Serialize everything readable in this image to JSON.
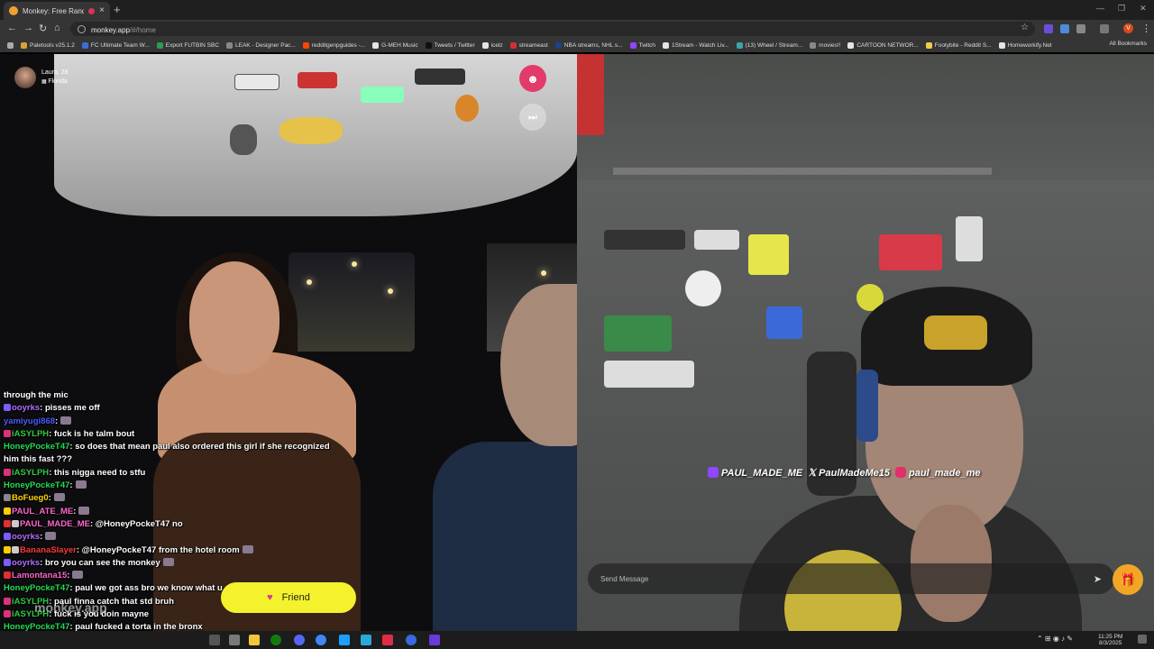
{
  "browser": {
    "tab_title": "Monkey: Free Random Vid",
    "url_host": "monkey.app",
    "url_path": "/#/home",
    "all_bookmarks_label": "All Bookmarks",
    "profile_initial": "V",
    "bookmarks": [
      {
        "label": "Paletools v25.1.2",
        "color": "#d7a23a"
      },
      {
        "label": "FC Ultimate Team W...",
        "color": "#3a6ed7"
      },
      {
        "label": "Export FUTBIN SBC",
        "color": "#2e9b4f"
      },
      {
        "label": "LEAK - Designer Pac...",
        "color": "#888888"
      },
      {
        "label": "redditgenpguides -...",
        "color": "#ff4500"
      },
      {
        "label": "G-MEH Music",
        "color": "#e5e5e5"
      },
      {
        "label": "Tweets / Twitter",
        "color": "#111111"
      },
      {
        "label": "icelz",
        "color": "#e5e5e5"
      },
      {
        "label": "streameast",
        "color": "#d32f2f"
      },
      {
        "label": "NBA streams, NHL s...",
        "color": "#1d428a"
      },
      {
        "label": "Twitch",
        "color": "#9146ff"
      },
      {
        "label": "1Stream - Watch Liv...",
        "color": "#e5e5e5"
      },
      {
        "label": "(13) Wheel / Stream...",
        "color": "#3aa6a6"
      },
      {
        "label": "movies!!",
        "color": "#888888"
      },
      {
        "label": "CARTOON NETWOR...",
        "color": "#e5e5e5"
      },
      {
        "label": "Footybite - Reddit S...",
        "color": "#f2c94c"
      },
      {
        "label": "Homeworkify.Net",
        "color": "#e5e5e5"
      }
    ]
  },
  "stranger": {
    "name_age": "Laura, 28",
    "location": "Florida"
  },
  "chat": [
    {
      "user": "",
      "user_color": "#ffffff",
      "badges": [],
      "text": "through the mic",
      "emote": false
    },
    {
      "user": "ooyrks",
      "user_color": "#b36bff",
      "badges": [
        "#7b5cff"
      ],
      "text": ": pisses me off",
      "emote": false
    },
    {
      "user": "yamiyugi868",
      "user_color": "#4a5cff",
      "badges": [],
      "text": ":",
      "emote": true
    },
    {
      "user": "iASYLPH",
      "user_color": "#2ecc40",
      "badges": [
        "#e0307a"
      ],
      "text": ": fuck is he talm bout",
      "emote": false
    },
    {
      "user": "HoneyPockeT47",
      "user_color": "#22dd55",
      "badges": [],
      "text": ": so does that mean paul also ordered this girl if she recognized him this fast ???",
      "emote": false
    },
    {
      "user": "iASYLPH",
      "user_color": "#2ecc40",
      "badges": [
        "#e0307a"
      ],
      "text": ": this nigga need to stfu",
      "emote": false
    },
    {
      "user": "HoneyPockeT47",
      "user_color": "#22dd55",
      "badges": [],
      "text": ":",
      "emote": true
    },
    {
      "user": "BoFueg0",
      "user_color": "#ffd400",
      "badges": [
        "#888888"
      ],
      "text": ":",
      "emote": true
    },
    {
      "user": "PAUL_ATE_ME",
      "user_color": "#ff66cc",
      "badges": [
        "#ffcc00"
      ],
      "text": ":",
      "emote": true
    },
    {
      "user": "PAUL_MADE_ME",
      "user_color": "#ff66cc",
      "badges": [
        "#e03030",
        "#cccccc"
      ],
      "text": ": @HoneyPockeT47 no",
      "emote": false
    },
    {
      "user": "ooyrks",
      "user_color": "#b36bff",
      "badges": [
        "#7b5cff"
      ],
      "text": ":",
      "emote": true
    },
    {
      "user": "BananaSlayer",
      "user_color": "#ff3b3b",
      "badges": [
        "#ffcc00",
        "#cccccc"
      ],
      "text": ": @HoneyPockeT47 from the hotel room",
      "emote": true
    },
    {
      "user": "ooyrks",
      "user_color": "#b36bff",
      "badges": [
        "#7b5cff"
      ],
      "text": ": bro you can see the monkey",
      "emote": true
    },
    {
      "user": "Lamontana15",
      "user_color": "#ff66cc",
      "badges": [
        "#e03030"
      ],
      "text": ":",
      "emote": true
    },
    {
      "user": "HoneyPockeT47",
      "user_color": "#22dd55",
      "badges": [],
      "text": ": paul we got  ass bro we know what u did in the bronx",
      "emote": false
    },
    {
      "user": "",
      "user_color": "#ffffff",
      "badges": [],
      "text": "",
      "emote": false
    },
    {
      "user": "iASYLPH",
      "user_color": "#2ecc40",
      "badges": [
        "#e0307a"
      ],
      "text": ": paul finna catch that std bruh",
      "emote": false
    },
    {
      "user": "iASYLPH",
      "user_color": "#2ecc40",
      "badges": [
        "#e0307a"
      ],
      "text": ": fuck is you doin mayne",
      "emote": false
    },
    {
      "user": "HoneyPockeT47",
      "user_color": "#22dd55",
      "badges": [],
      "text": ": paul fucked a torta in the bronx",
      "emote": false
    }
  ],
  "watermark": "monkey.app",
  "friend_label": "Friend",
  "socials": {
    "twitch": "PAUL_MADE_ME",
    "x": "PaulMadeMe15",
    "instagram": "paul_made_me"
  },
  "send_placeholder": "Send Message",
  "taskbar": {
    "time": "11:25 PM",
    "date": "8/3/2025"
  },
  "colors": {
    "friend_button": "#f4f22c",
    "gift_button": "#f2a626",
    "report_button": "#e23b6b"
  }
}
